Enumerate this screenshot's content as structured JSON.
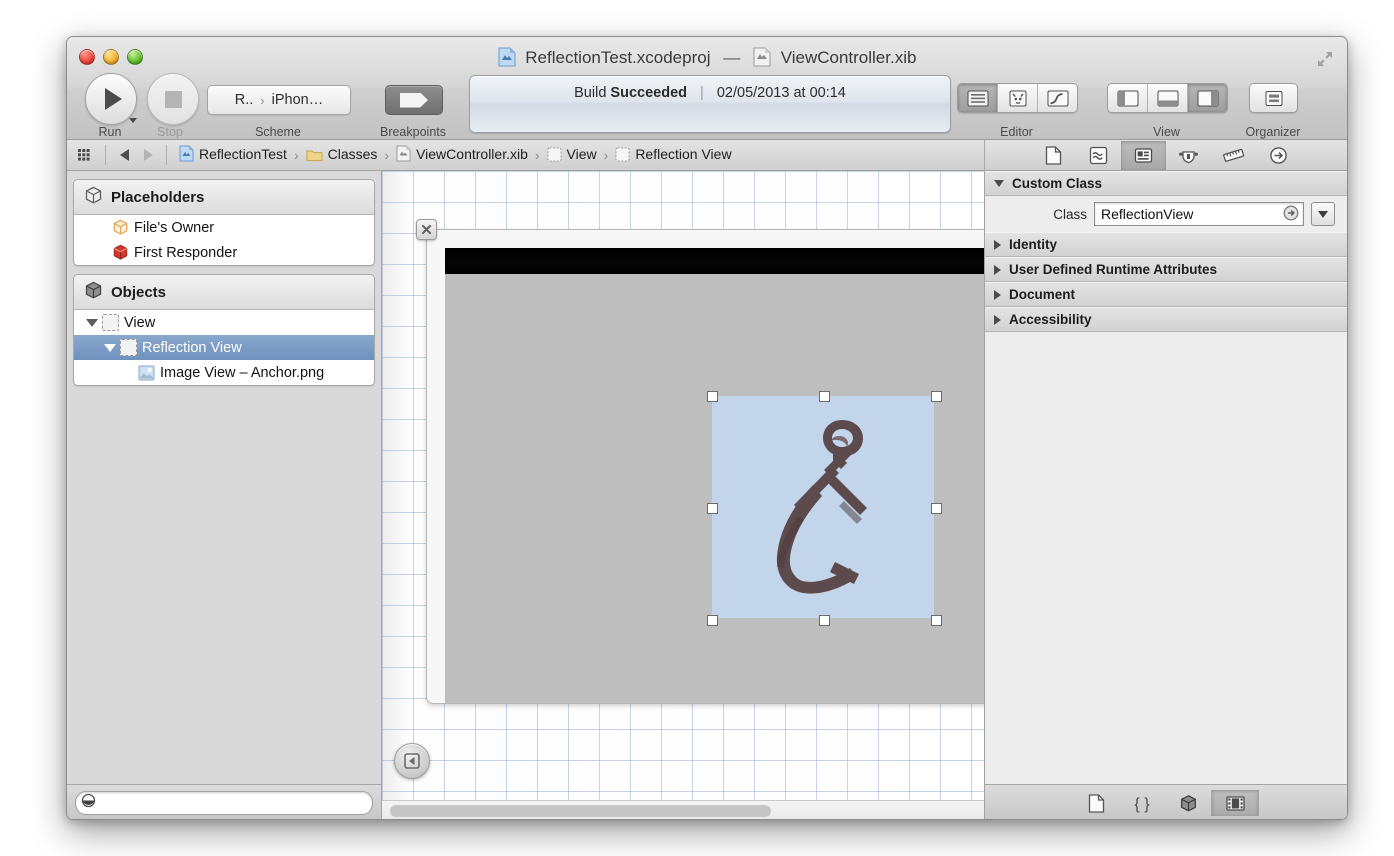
{
  "window": {
    "title_project": "ReflectionTest.xcodeproj",
    "title_dash": "—",
    "title_file": "ViewController.xib"
  },
  "toolbar": {
    "run_label": "Run",
    "stop_label": "Stop",
    "scheme_label": "Scheme",
    "scheme_target": "R..",
    "scheme_sep": "›",
    "scheme_device": "iPhon…",
    "breakpoints_label": "Breakpoints",
    "editor_label": "Editor",
    "view_label": "View",
    "organizer_label": "Organizer",
    "editor_segments": [
      {
        "name": "standard-editor",
        "selected": true
      },
      {
        "name": "assistant-editor",
        "selected": false
      },
      {
        "name": "version-editor",
        "selected": false
      }
    ],
    "view_segments": [
      {
        "name": "navigator-toggle",
        "selected": false
      },
      {
        "name": "debug-area-toggle",
        "selected": false
      },
      {
        "name": "utilities-toggle",
        "selected": true
      }
    ]
  },
  "status": {
    "prefix": "Build",
    "result": "Succeeded",
    "divider": "|",
    "timestamp": "02/05/2013 at 00:14"
  },
  "breadcrumb": {
    "items": [
      {
        "label": "ReflectionTest",
        "icon": "xcodeproj-icon"
      },
      {
        "label": "Classes",
        "icon": "folder-icon"
      },
      {
        "label": "ViewController.xib",
        "icon": "xib-icon"
      },
      {
        "label": "View",
        "icon": "view-icon"
      },
      {
        "label": "Reflection View",
        "icon": "view-icon"
      }
    ],
    "separator": "›"
  },
  "inspector_tabs": [
    {
      "name": "file-inspector",
      "selected": false
    },
    {
      "name": "quick-help-inspector",
      "selected": false
    },
    {
      "name": "identity-inspector",
      "selected": true
    },
    {
      "name": "attributes-inspector",
      "selected": false
    },
    {
      "name": "size-inspector",
      "selected": false
    },
    {
      "name": "connections-inspector",
      "selected": false
    }
  ],
  "navigator": {
    "placeholders": {
      "header": "Placeholders",
      "items": [
        {
          "label": "File's Owner",
          "icon": "wireframe-cube-icon"
        },
        {
          "label": "First Responder",
          "icon": "red-cube-icon"
        }
      ]
    },
    "objects": {
      "header": "Objects",
      "items": [
        {
          "label": "View",
          "indent": 0,
          "expanded": true,
          "selected": false,
          "icon": "view-icon"
        },
        {
          "label": "Reflection View",
          "indent": 1,
          "expanded": true,
          "selected": true,
          "icon": "view-icon"
        },
        {
          "label": "Image View – Anchor.png",
          "indent": 2,
          "expanded": null,
          "selected": false,
          "icon": "image-view-icon"
        }
      ]
    },
    "filter_placeholder": ""
  },
  "inspector": {
    "sections": [
      {
        "label": "Custom Class",
        "expanded": true
      },
      {
        "label": "Identity",
        "expanded": false
      },
      {
        "label": "User Defined Runtime Attributes",
        "expanded": false
      },
      {
        "label": "Document",
        "expanded": false
      },
      {
        "label": "Accessibility",
        "expanded": false
      }
    ],
    "custom_class": {
      "field_label": "Class",
      "field_value": "ReflectionView"
    },
    "library_segments": [
      {
        "name": "file-template-library",
        "selected": false
      },
      {
        "name": "code-snippet-library",
        "selected": false
      },
      {
        "name": "object-library",
        "selected": false
      },
      {
        "name": "media-library",
        "selected": true
      }
    ]
  },
  "canvas": {
    "status_bar_color": "#000000",
    "device_view_color": "#bebebe",
    "image_view_bg": "#c3d5ea",
    "selection_handle_count": 8,
    "grid_color": "#96b2d6"
  },
  "colors": {
    "selection_blue": "#7a9cc6",
    "toolbar_gray": "#d0d0d0",
    "accent": "#c3d5ea"
  }
}
